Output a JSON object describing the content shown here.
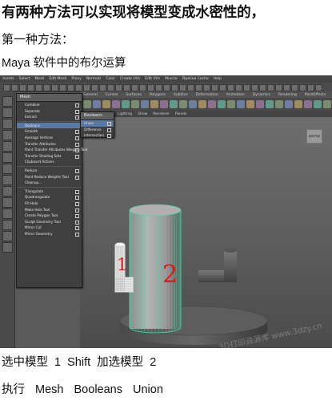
{
  "document": {
    "heading": "有两种方法可以实现将模型变成水密性的，",
    "method_label": "第一种方法：",
    "subtitle": "Maya 软件中的布尔运算",
    "caption_select": "选中模型 1      Shift  加选模型 2",
    "caption_execute": "执行 Mesh    Booleans    Union"
  },
  "maya": {
    "menubar": [
      "Assets",
      "Select",
      "Mesh",
      "Edit Mesh",
      "Proxy",
      "Normals",
      "Color",
      "Create UVs",
      "Edit UVs",
      "Muscle",
      "Pipeline Cache",
      "Help"
    ],
    "shelf_tabs": [
      "General",
      "Curves",
      "Surfaces",
      "Polygons",
      "Subdivs",
      "Deformation",
      "Animation",
      "Dynamics",
      "Rendering",
      "PaintEffects",
      "Toon",
      "Muscle",
      "Fluids",
      "Fur",
      "Hair",
      "nCloth",
      "Custom"
    ],
    "panel_menu": [
      "View",
      "Shading",
      "Lighting",
      "Show",
      "Renderer",
      "Panels"
    ],
    "mesh_menu": {
      "title": "Mesh",
      "items": [
        "Combine",
        "Separate",
        "Extract",
        "Booleans",
        "Smooth",
        "Average Vertices",
        "Transfer Attributes",
        "Paint Transfer Attributes Weights Tool",
        "Transfer Shading Sets",
        "Clipboard Actions",
        "Reduce",
        "Paint Reduce Weights Tool",
        "Cleanup...",
        "Triangulate",
        "Quadrangulate",
        "Fill Hole",
        "Make Hole Tool",
        "Create Polygon Tool",
        "Sculpt Geometry Tool",
        "Mirror Cut",
        "Mirror Geometry"
      ]
    },
    "booleans_menu": {
      "title": "Booleans",
      "items": [
        "Union",
        "Difference",
        "Intersection"
      ],
      "selected": "Union"
    },
    "labels": {
      "model_1": "1",
      "model_2": "2"
    },
    "view_cube_label": "persp",
    "watermark": "3D打印资源库 www.3dzy.cn"
  },
  "colors": {
    "menu_highlight": "#5879a6",
    "wireframe_selected": "#3fd9a8",
    "label_red": "#e01818"
  }
}
